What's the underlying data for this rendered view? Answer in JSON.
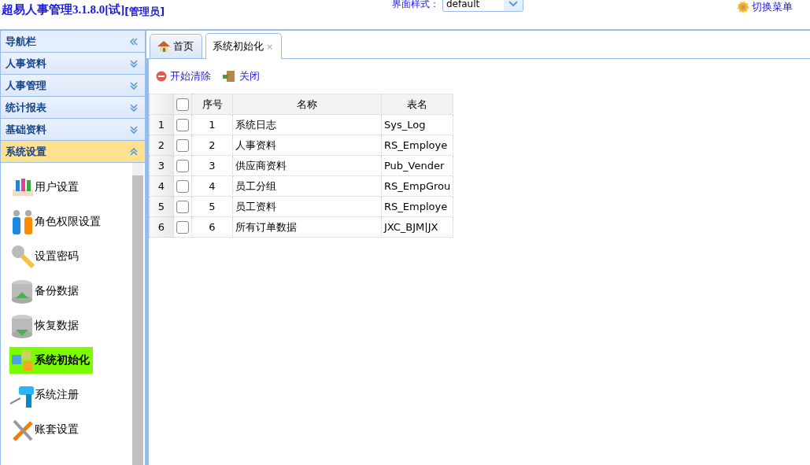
{
  "header": {
    "title": "超易人事管理3.1.8.0[试]",
    "role": "[管理员]",
    "style_label": "界面样式：",
    "style_value": "default",
    "switch_menu": "切换菜单"
  },
  "sidebar": {
    "title": "导航栏",
    "sections": [
      {
        "label": "人事资料",
        "expanded": false
      },
      {
        "label": "人事管理",
        "expanded": false
      },
      {
        "label": "统计报表",
        "expanded": false
      },
      {
        "label": "基础资料",
        "expanded": false
      },
      {
        "label": "系统设置",
        "expanded": true
      }
    ],
    "items": [
      {
        "label": "用户设置",
        "selected": false
      },
      {
        "label": "角色权限设置",
        "selected": false
      },
      {
        "label": "设置密码",
        "selected": false
      },
      {
        "label": "备份数据",
        "selected": false
      },
      {
        "label": "恢复数据",
        "selected": false
      },
      {
        "label": "系统初始化",
        "selected": true
      },
      {
        "label": "系统注册",
        "selected": false
      },
      {
        "label": "账套设置",
        "selected": false
      }
    ]
  },
  "tabs": [
    {
      "label": "首页",
      "selected": false
    },
    {
      "label": "系统初始化",
      "selected": true,
      "close": "×"
    }
  ],
  "toolbar": [
    {
      "label": "开始清除"
    },
    {
      "label": "关闭"
    }
  ],
  "table": {
    "select_all_checked": false,
    "columns": [
      "序号",
      "名称",
      "表名"
    ],
    "rows": [
      {
        "row": "1",
        "checked": false,
        "cells": [
          "1",
          "系统日志",
          "Sys_Log"
        ]
      },
      {
        "row": "2",
        "checked": false,
        "cells": [
          "2",
          "人事资料",
          "RS_Employe"
        ]
      },
      {
        "row": "3",
        "checked": false,
        "cells": [
          "3",
          "供应商资料",
          "Pub_Vender"
        ]
      },
      {
        "row": "4",
        "checked": false,
        "cells": [
          "4",
          "员工分组",
          "RS_EmpGrou"
        ]
      },
      {
        "row": "5",
        "checked": false,
        "cells": [
          "5",
          "员工资料",
          "RS_Employe"
        ]
      },
      {
        "row": "6",
        "checked": false,
        "cells": [
          "6",
          "所有订单数据",
          "JXC_BJM|JX"
        ]
      }
    ]
  }
}
